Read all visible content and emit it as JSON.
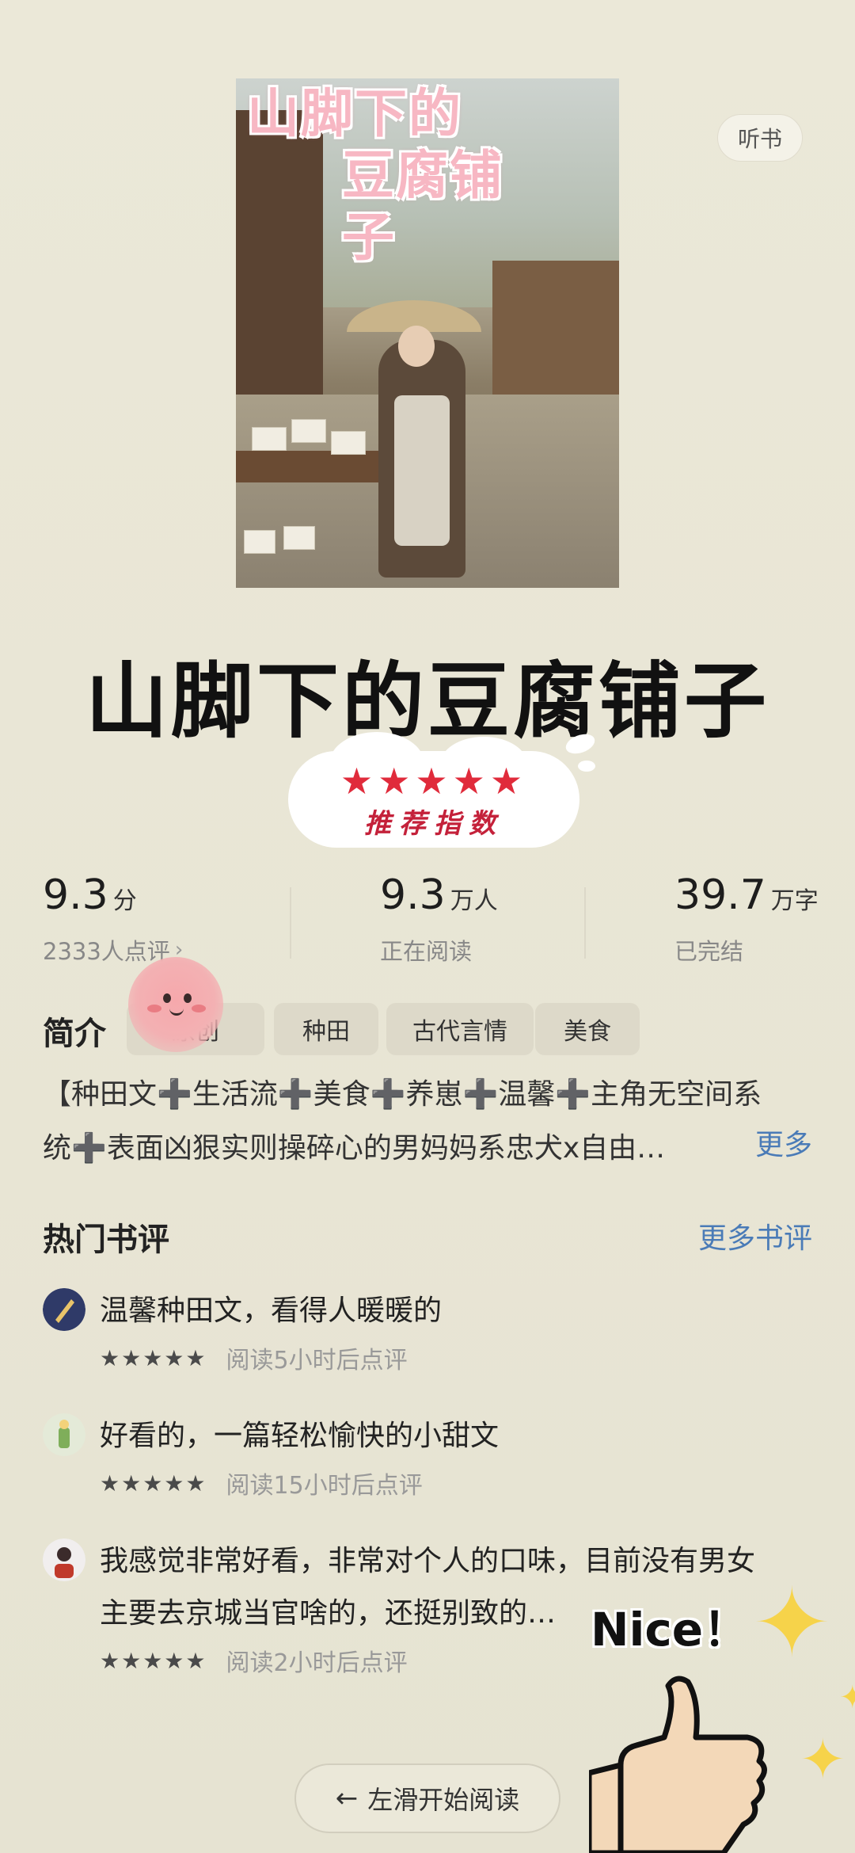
{
  "cover": {
    "title_line1": "山脚下的",
    "title_line2": "豆腐铺子"
  },
  "listen_label": "听书",
  "book_title": "山脚下的豆腐铺子",
  "recommend": {
    "stars": "★★★★★",
    "label": "推荐指数"
  },
  "stats": {
    "rating": {
      "value": "9.3",
      "unit": "分",
      "sub": "2333人点评"
    },
    "readers": {
      "value": "9.3",
      "unit": "万人",
      "sub": "正在阅读"
    },
    "words": {
      "value": "39.7",
      "unit": "万字",
      "sub": "已完结"
    }
  },
  "intro": {
    "label": "简介",
    "tags": [
      "原创",
      "种田",
      "古代言情",
      "美食"
    ],
    "line1": "【种田文➕生活流➕美食➕养崽➕温馨➕主角无空间系",
    "line2": "统➕表面凶狠实则操碎心的男妈妈系忠犬x自由…",
    "more": "更多"
  },
  "reviews": {
    "title": "热门书评",
    "more": "更多书评",
    "items": [
      {
        "text": "温馨种田文，看得人暖暖的",
        "stars": "★★★★★",
        "meta": "阅读5小时后点评"
      },
      {
        "text": "好看的，一篇轻松愉快的小甜文",
        "stars": "★★★★★",
        "meta": "阅读15小时后点评"
      },
      {
        "text_line1": "我感觉非常好看，非常对个人的口味，目前没有男女",
        "text_line2": "主要去京城当官啥的，还挺别致的…",
        "stars": "★★★★★",
        "meta": "阅读2小时后点评"
      }
    ]
  },
  "sticker_text": "Nice！",
  "start_reading": "左滑开始阅读",
  "colors": {
    "accent_blue": "#4a7bb7",
    "star_red": "#e02b3b",
    "background": "#e9e6d6"
  }
}
